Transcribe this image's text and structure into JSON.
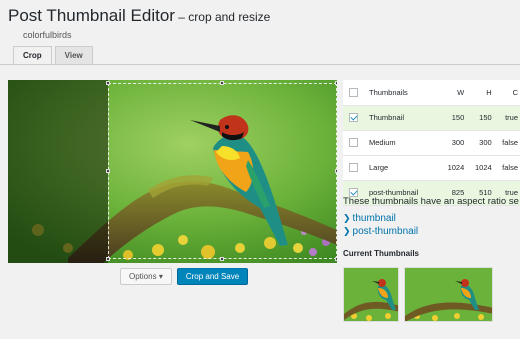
{
  "header": {
    "title": "Post Thumbnail Editor",
    "separator": " – ",
    "subtitle": "crop and resize",
    "username": "colorfulbirds"
  },
  "tabs": [
    {
      "label": "Crop",
      "active": true
    },
    {
      "label": "View",
      "active": false
    }
  ],
  "editor": {
    "options_label": "Options",
    "options_caret": "▾",
    "crop_save_label": "Crop and Save"
  },
  "table": {
    "headers": {
      "name": "Thumbnails",
      "w": "W",
      "h": "H",
      "c": "C"
    },
    "rows": [
      {
        "name": "Thumbnail",
        "w": "150",
        "h": "150",
        "c": "true",
        "checked": true
      },
      {
        "name": "Medium",
        "w": "300",
        "h": "300",
        "c": "false",
        "checked": false
      },
      {
        "name": "Large",
        "w": "1024",
        "h": "1024",
        "c": "false",
        "checked": false
      },
      {
        "name": "post-thumbnail",
        "w": "825",
        "h": "510",
        "c": "true",
        "checked": true
      }
    ]
  },
  "note": "These thumbnails have an aspect ratio se",
  "links": [
    "thumbnail",
    "post-thumbnail"
  ],
  "current_thumbnails_label": "Current Thumbnails",
  "colors": {
    "accent": "#0085ba",
    "link": "#0073aa",
    "row_highlight": "#e9f7e0"
  }
}
